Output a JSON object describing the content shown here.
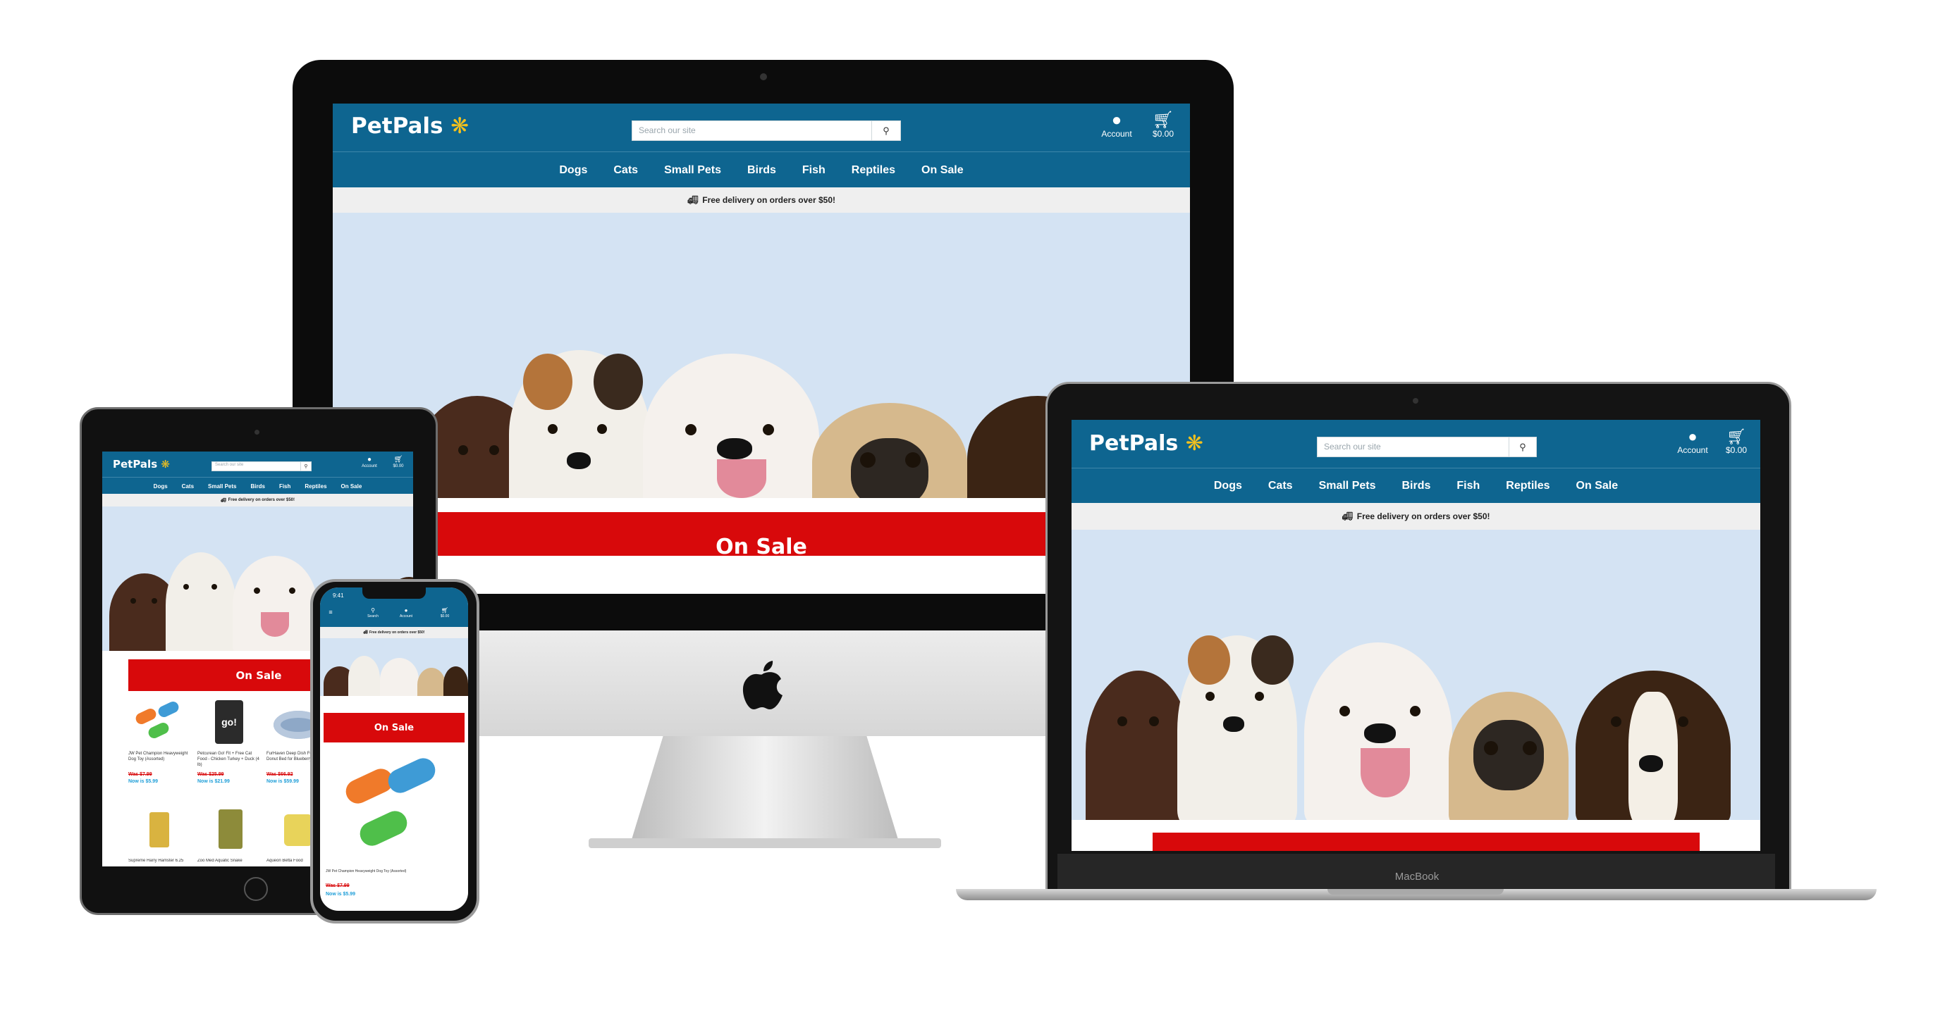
{
  "brand": {
    "name": "PetPals",
    "paw_icon": "paw-icon",
    "header_color": "#0e6590",
    "accent": "#f4c11c",
    "sale_color": "#d8090b"
  },
  "search": {
    "placeholder": "Search our site",
    "icon": "search-icon"
  },
  "header": {
    "account_label": "Account",
    "account_icon": "user-icon",
    "cart_total": "$0.00",
    "cart_icon": "cart-icon",
    "search_label": "Search"
  },
  "nav": {
    "items": [
      {
        "label": "Dogs"
      },
      {
        "label": "Cats"
      },
      {
        "label": "Small Pets"
      },
      {
        "label": "Birds"
      },
      {
        "label": "Fish"
      },
      {
        "label": "Reptiles"
      },
      {
        "label": "On Sale"
      }
    ]
  },
  "promo": {
    "text": "Free delivery on orders over $50!",
    "icon": "truck-icon"
  },
  "sale_banner": {
    "title": "On Sale"
  },
  "phone": {
    "status_time": "9:41",
    "menu_icon": "menu-icon"
  },
  "laptop": {
    "label": "MacBook"
  },
  "products": [
    {
      "name": "JW Pet Champion Heavyweight Dog Toy (Assorted)",
      "was": "Was $7.99",
      "now": "Now is $5.99"
    },
    {
      "name": "Petcurean Go! Fit + Free Cat Food - Chicken Turkey + Duck (4 lb)",
      "was": "Was $25.99",
      "now": "Now is $21.99"
    },
    {
      "name": "FurHaven Deep Dish Fur Plush Donut Bed for Blueberry",
      "was": "Was $66.92",
      "now": "Now is $59.99"
    },
    {
      "name": "Supreme Harry Hamster 6.25",
      "was": "",
      "now": ""
    },
    {
      "name": "Zoo Med Aquatic Snake",
      "was": "",
      "now": ""
    },
    {
      "name": "Aqueon Betta Food",
      "was": "",
      "now": ""
    }
  ],
  "phone_product": {
    "name": "JW Pet Champion Heavyweight Dog Toy (Assorted)",
    "was": "Was $7.99",
    "now": "Now is $5.99"
  }
}
